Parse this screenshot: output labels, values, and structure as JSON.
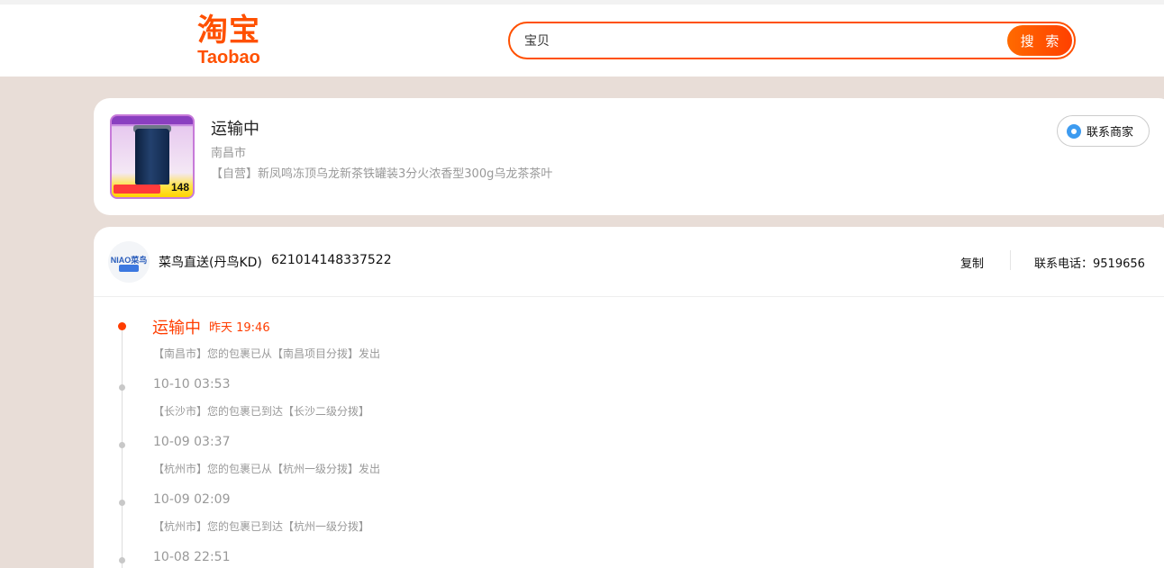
{
  "header": {
    "logo_cn": "淘宝",
    "logo_en": "Taobao",
    "search_value": "宝贝",
    "search_button": "搜 索"
  },
  "order": {
    "status": "运输中",
    "city": "南昌市",
    "product_name": "【自营】新凤鸣冻顶乌龙新茶铁罐装3分火浓香型300g乌龙茶茶叶",
    "thumb_price": "148",
    "contact_merchant": "联系商家"
  },
  "logistics": {
    "carrier_logo_text": "NIAO菜鸟",
    "carrier_name": "菜鸟直送(丹鸟KD)",
    "tracking_number": "621014148337522",
    "copy_label": "复制",
    "phone_label": "联系电话：9519656"
  },
  "timeline": [
    {
      "status": "运输中",
      "time": "昨天 19:46",
      "desc": "【南昌市】您的包裹已从【南昌项目分拨】发出",
      "active": true
    },
    {
      "time": "10-10 03:53",
      "desc": "【长沙市】您的包裹已到达【长沙二级分拨】"
    },
    {
      "time": "10-09 03:37",
      "desc": "【杭州市】您的包裹已从【杭州一级分拨】发出"
    },
    {
      "time": "10-09 02:09",
      "desc": "【杭州市】您的包裹已到达【杭州一级分拨】"
    },
    {
      "time": "10-08 22:51",
      "desc": ""
    }
  ],
  "colors": {
    "brand": "#ff5000",
    "active": "#ff3d00",
    "page_bg": "#e8ddd7"
  }
}
